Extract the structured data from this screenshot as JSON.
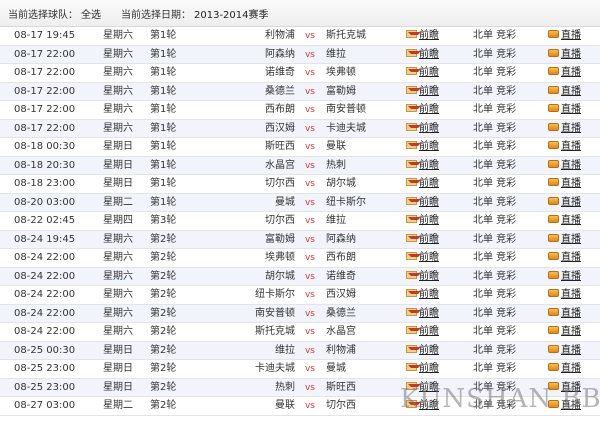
{
  "header": {
    "team_label": "当前选择球队：",
    "team_value": "全选",
    "date_label": "当前选择日期：",
    "date_value": "2013-2014赛季"
  },
  "common": {
    "vs": "vs",
    "preview": "前瞻",
    "lottery": "北单 竞彩",
    "live": "直播"
  },
  "matches": [
    {
      "date": "08-17 19:45",
      "weekday": "星期六",
      "round": "第1轮",
      "home": "利物浦",
      "away": "斯托克城"
    },
    {
      "date": "08-17 22:00",
      "weekday": "星期六",
      "round": "第1轮",
      "home": "阿森纳",
      "away": "维拉"
    },
    {
      "date": "08-17 22:00",
      "weekday": "星期六",
      "round": "第1轮",
      "home": "诺维奇",
      "away": "埃弗顿"
    },
    {
      "date": "08-17 22:00",
      "weekday": "星期六",
      "round": "第1轮",
      "home": "桑德兰",
      "away": "富勒姆"
    },
    {
      "date": "08-17 22:00",
      "weekday": "星期六",
      "round": "第1轮",
      "home": "西布朗",
      "away": "南安普顿"
    },
    {
      "date": "08-17 22:00",
      "weekday": "星期六",
      "round": "第1轮",
      "home": "西汉姆",
      "away": "卡迪夫城"
    },
    {
      "date": "08-18 00:30",
      "weekday": "星期日",
      "round": "第1轮",
      "home": "斯旺西",
      "away": "曼联"
    },
    {
      "date": "08-18 20:30",
      "weekday": "星期日",
      "round": "第1轮",
      "home": "水晶宫",
      "away": "热刺"
    },
    {
      "date": "08-18 23:00",
      "weekday": "星期日",
      "round": "第1轮",
      "home": "切尔西",
      "away": "胡尔城"
    },
    {
      "date": "08-20 03:00",
      "weekday": "星期二",
      "round": "第1轮",
      "home": "曼城",
      "away": "纽卡斯尔"
    },
    {
      "date": "08-22 02:45",
      "weekday": "星期四",
      "round": "第3轮",
      "home": "切尔西",
      "away": "维拉"
    },
    {
      "date": "08-24 19:45",
      "weekday": "星期六",
      "round": "第2轮",
      "home": "富勒姆",
      "away": "阿森纳"
    },
    {
      "date": "08-24 22:00",
      "weekday": "星期六",
      "round": "第2轮",
      "home": "埃弗顿",
      "away": "西布朗"
    },
    {
      "date": "08-24 22:00",
      "weekday": "星期六",
      "round": "第2轮",
      "home": "胡尔城",
      "away": "诺维奇"
    },
    {
      "date": "08-24 22:00",
      "weekday": "星期六",
      "round": "第2轮",
      "home": "纽卡斯尔",
      "away": "西汉姆"
    },
    {
      "date": "08-24 22:00",
      "weekday": "星期六",
      "round": "第2轮",
      "home": "南安普顿",
      "away": "桑德兰"
    },
    {
      "date": "08-24 22:00",
      "weekday": "星期六",
      "round": "第2轮",
      "home": "斯托克城",
      "away": "水晶宫"
    },
    {
      "date": "08-25 00:30",
      "weekday": "星期日",
      "round": "第2轮",
      "home": "维拉",
      "away": "利物浦"
    },
    {
      "date": "08-25 23:00",
      "weekday": "星期日",
      "round": "第2轮",
      "home": "卡迪夫城",
      "away": "曼城"
    },
    {
      "date": "08-25 23:00",
      "weekday": "星期日",
      "round": "第2轮",
      "home": "热刺",
      "away": "斯旺西"
    },
    {
      "date": "08-27 03:00",
      "weekday": "星期二",
      "round": "第2轮",
      "home": "曼联",
      "away": "切尔西"
    }
  ],
  "watermark": "KUNSHAN BBS"
}
